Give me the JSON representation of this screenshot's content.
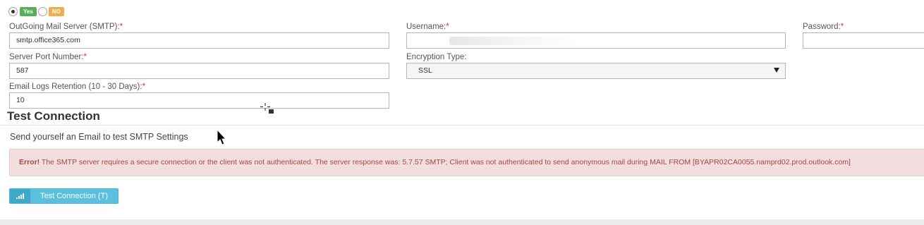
{
  "smtp_toggle": {
    "yes_label": "Yes",
    "no_label": "NO",
    "selected": "Yes"
  },
  "fields": {
    "smtp_server": {
      "label": "OutGoing Mail Server (SMTP):",
      "required_mark": "*",
      "value": "smtp.office365.com"
    },
    "username": {
      "label": "Username:",
      "required_mark": "*",
      "value": ""
    },
    "password": {
      "label": "Password:",
      "required_mark": "*",
      "value": ""
    },
    "port": {
      "label": "Server Port Number:",
      "required_mark": "*",
      "value": "587"
    },
    "encryption": {
      "label": "Encryption Type:",
      "value": "SSL"
    },
    "retention": {
      "label": "Email Logs Retention (10 - 30 Days):",
      "required_mark": "*",
      "value": "10"
    }
  },
  "test_section": {
    "title": "Test Connection",
    "description": "Send yourself an Email to test SMTP Settings",
    "error_strong": "Error!",
    "error_message": "The SMTP server requires a secure connection or the client was not authenticated. The server response was: 5.7.57 SMTP; Client was not authenticated to send anonymous mail during MAIL FROM [BYAPR02CA0055.namprd02.prod.outlook.com]",
    "button_label": "Test Connection (T)",
    "button_icon": "signal-bars-icon"
  },
  "colors": {
    "required": "#d9322f",
    "yes_badge": "#56b058",
    "no_badge": "#f0ad4e",
    "alert_bg": "#f2dede",
    "alert_text": "#a94442",
    "button_bg": "#5bc0de"
  }
}
